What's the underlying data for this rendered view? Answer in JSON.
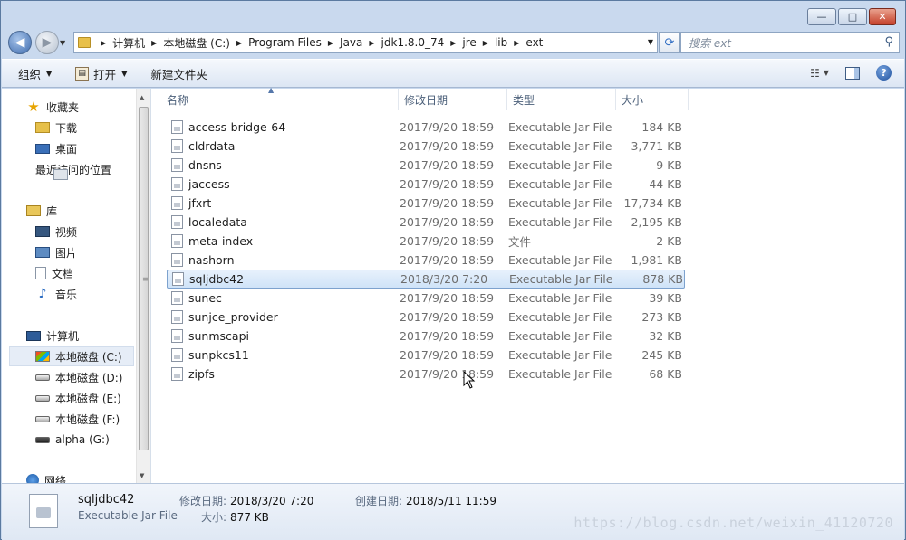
{
  "window": {
    "minimize_glyph": "—",
    "maximize_glyph": "□",
    "close_glyph": "✕"
  },
  "address": {
    "crumbs": [
      "计算机",
      "本地磁盘 (C:)",
      "Program Files",
      "Java",
      "jdk1.8.0_74",
      "jre",
      "lib",
      "ext"
    ]
  },
  "search": {
    "placeholder": "搜索 ext"
  },
  "toolbar": {
    "organize": "组织",
    "open": "打开",
    "new_folder": "新建文件夹"
  },
  "nav": {
    "favorites": "收藏夹",
    "downloads": "下载",
    "desktop": "桌面",
    "recent": "最近访问的位置",
    "libraries": "库",
    "videos": "视频",
    "pictures": "图片",
    "documents": "文档",
    "music": "音乐",
    "computer": "计算机",
    "drive_c": "本地磁盘 (C:)",
    "drive_d": "本地磁盘 (D:)",
    "drive_e": "本地磁盘 (E:)",
    "drive_f": "本地磁盘 (F:)",
    "drive_g": "alpha (G:)",
    "network": "网络"
  },
  "columns": {
    "name": "名称",
    "date": "修改日期",
    "type": "类型",
    "size": "大小"
  },
  "files": [
    {
      "name": "access-bridge-64",
      "date": "2017/9/20 18:59",
      "type": "Executable Jar File",
      "size": "184 KB"
    },
    {
      "name": "cldrdata",
      "date": "2017/9/20 18:59",
      "type": "Executable Jar File",
      "size": "3,771 KB"
    },
    {
      "name": "dnsns",
      "date": "2017/9/20 18:59",
      "type": "Executable Jar File",
      "size": "9 KB"
    },
    {
      "name": "jaccess",
      "date": "2017/9/20 18:59",
      "type": "Executable Jar File",
      "size": "44 KB"
    },
    {
      "name": "jfxrt",
      "date": "2017/9/20 18:59",
      "type": "Executable Jar File",
      "size": "17,734 KB"
    },
    {
      "name": "localedata",
      "date": "2017/9/20 18:59",
      "type": "Executable Jar File",
      "size": "2,195 KB"
    },
    {
      "name": "meta-index",
      "date": "2017/9/20 18:59",
      "type": "文件",
      "size": "2 KB"
    },
    {
      "name": "nashorn",
      "date": "2017/9/20 18:59",
      "type": "Executable Jar File",
      "size": "1,981 KB"
    },
    {
      "name": "sqljdbc42",
      "date": "2018/3/20 7:20",
      "type": "Executable Jar File",
      "size": "878 KB"
    },
    {
      "name": "sunec",
      "date": "2017/9/20 18:59",
      "type": "Executable Jar File",
      "size": "39 KB"
    },
    {
      "name": "sunjce_provider",
      "date": "2017/9/20 18:59",
      "type": "Executable Jar File",
      "size": "273 KB"
    },
    {
      "name": "sunmscapi",
      "date": "2017/9/20 18:59",
      "type": "Executable Jar File",
      "size": "32 KB"
    },
    {
      "name": "sunpkcs11",
      "date": "2017/9/20 18:59",
      "type": "Executable Jar File",
      "size": "245 KB"
    },
    {
      "name": "zipfs",
      "date": "2017/9/20 18:59",
      "type": "Executable Jar File",
      "size": "68 KB"
    }
  ],
  "details": {
    "name": "sqljdbc42",
    "type": "Executable Jar File",
    "modified_label": "修改日期:",
    "modified_value": "2018/3/20 7:20",
    "created_label": "创建日期:",
    "created_value": "2018/5/11 11:59",
    "size_label": "大小:",
    "size_value": "877 KB"
  },
  "watermark": "https://blog.csdn.net/weixin_41120720"
}
